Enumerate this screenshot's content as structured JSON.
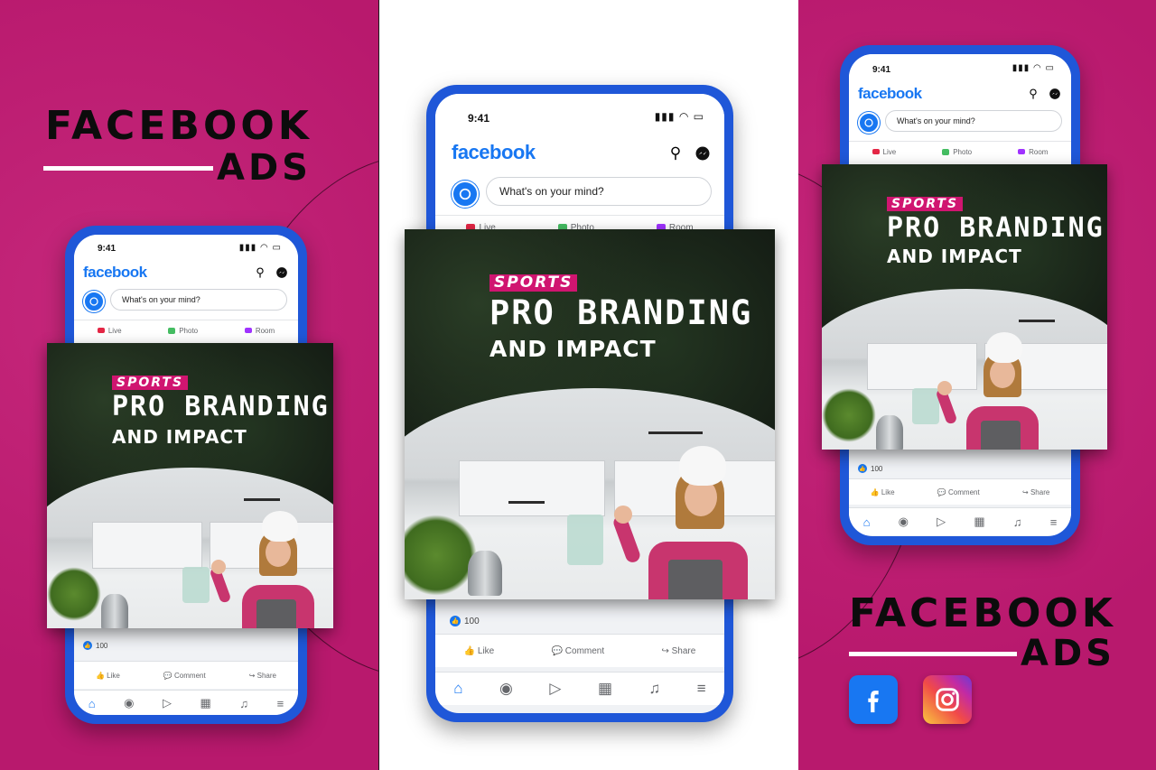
{
  "headline": {
    "line1": "FACEBOOK",
    "line2": "ADS"
  },
  "phone": {
    "time": "9:41",
    "brand": "facebook",
    "composer_placeholder": "What's on your mind?",
    "composer_actions": [
      "Live",
      "Photo",
      "Room"
    ],
    "like_count": "100",
    "reactions": [
      "Like",
      "Comment",
      "Share"
    ]
  },
  "post": {
    "tag": "SPORTS",
    "title": "PRO BRANDING",
    "subtitle": "AND IMPACT"
  },
  "social_icons": [
    "facebook-logo-icon",
    "instagram-logo-icon"
  ],
  "colors": {
    "background_pink": "#c21a73",
    "phone_frame": "#1f57d8",
    "facebook_blue": "#1877f2",
    "tag_pink": "#d01570"
  }
}
